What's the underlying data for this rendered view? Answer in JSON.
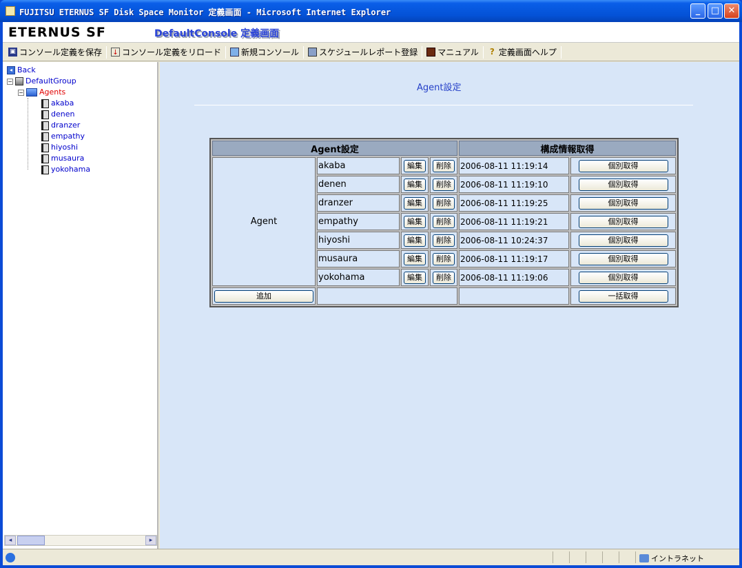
{
  "window": {
    "title": "FUJITSU ETERNUS SF Disk Space Monitor 定義画面 - Microsoft Internet Explorer"
  },
  "banner": {
    "brand": "ETERNUS SF",
    "console_title": "DefaultConsole 定義画面"
  },
  "toolbar": {
    "items": [
      {
        "label": "コンソール定義を保存",
        "icon": "floppy-icon"
      },
      {
        "label": "コンソール定義をリロード",
        "icon": "reload-icon"
      },
      {
        "label": "新規コンソール",
        "icon": "new-console-icon"
      },
      {
        "label": "スケジュールレポート登録",
        "icon": "schedule-icon"
      },
      {
        "label": "マニュアル",
        "icon": "manual-icon"
      },
      {
        "label": "定義画面ヘルプ",
        "icon": "help-icon"
      }
    ]
  },
  "tree": {
    "back": "Back",
    "group": "DefaultGroup",
    "agents": "Agents",
    "agent_nodes": [
      "akaba",
      "denen",
      "dranzer",
      "empathy",
      "hiyoshi",
      "musaura",
      "yokohama"
    ]
  },
  "main": {
    "heading": "Agent設定",
    "table": {
      "header_left": "Agent設定",
      "header_right": "構成情報取得",
      "row_label": "Agent",
      "edit_label": "編集",
      "delete_label": "削除",
      "fetch_label": "個別取得",
      "add_label": "追加",
      "fetch_all_label": "一括取得",
      "rows": [
        {
          "name": "akaba",
          "date": "2006-08-11 11:19:14"
        },
        {
          "name": "denen",
          "date": "2006-08-11 11:19:10"
        },
        {
          "name": "dranzer",
          "date": "2006-08-11 11:19:25"
        },
        {
          "name": "empathy",
          "date": "2006-08-11 11:19:21"
        },
        {
          "name": "hiyoshi",
          "date": "2006-08-11 10:24:37"
        },
        {
          "name": "musaura",
          "date": "2006-08-11 11:19:17"
        },
        {
          "name": "yokohama",
          "date": "2006-08-11 11:19:06"
        }
      ]
    }
  },
  "statusbar": {
    "zone": "イントラネット"
  }
}
